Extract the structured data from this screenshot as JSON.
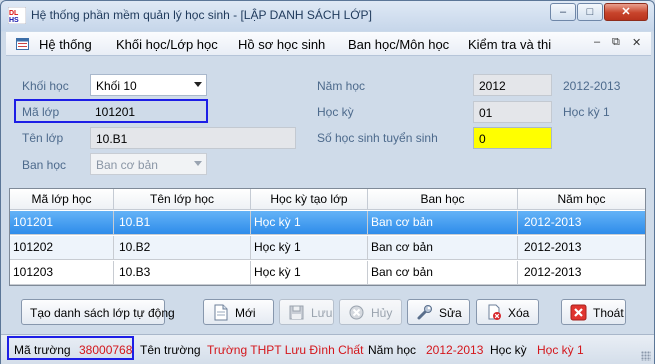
{
  "window": {
    "title": "Hệ thống phần mềm quản lý học sinh - [LẬP DANH SÁCH LỚP]",
    "min_symbol": "–",
    "max_symbol": "□",
    "close_symbol": "✕"
  },
  "menu": {
    "items": [
      "Hệ thống",
      "Khối học/Lớp học",
      "Hồ sơ học sinh",
      "Ban học/Môn học",
      "Kiểm tra và thi"
    ],
    "mdi_min": "–",
    "mdi_restore": "⧉",
    "mdi_close": "✕"
  },
  "form": {
    "khoi_hoc_label": "Khối học",
    "khoi_hoc_value": "Khối 10",
    "ma_lop_label": "Mã lớp",
    "ma_lop_value": "101201",
    "ten_lop_label": "Tên lớp",
    "ten_lop_value": "10.B1",
    "ban_hoc_label": "Ban học",
    "ban_hoc_value": "Ban cơ bản",
    "nam_hoc_label": "Năm học",
    "nam_hoc_value": "2012",
    "nam_hoc_text": "2012-2013",
    "hoc_ky_label": "Học kỳ",
    "hoc_ky_value": "01",
    "hoc_ky_text": "Học kỳ 1",
    "so_hs_label": "Số học sinh tuyển sinh",
    "so_hs_value": "0"
  },
  "grid": {
    "columns": [
      "Mã lớp học",
      "Tên lớp học",
      "Học kỳ tạo lớp",
      "Ban học",
      "Năm học"
    ],
    "rows": [
      [
        "101201",
        "10.B1",
        "Học kỳ 1",
        "Ban cơ bản",
        "2012-2013"
      ],
      [
        "101202",
        "10.B2",
        "Học kỳ 1",
        "Ban cơ bản",
        "2012-2013"
      ],
      [
        "101203",
        "10.B3",
        "Học kỳ 1",
        "Ban cơ bản",
        "2012-2013"
      ]
    ],
    "selected_row": 0
  },
  "buttons": {
    "auto_create": "Tạo danh sách lớp tự động",
    "new": "Mới",
    "save": "Lưu",
    "cancel": "Hủy",
    "edit": "Sửa",
    "delete": "Xóa",
    "exit": "Thoát"
  },
  "status": {
    "ma_truong_label": "Mã trường",
    "ma_truong_value": "38000768",
    "ten_truong_label": "Tên trường",
    "ten_truong_value": "Trường THPT Lưu Đình Chất",
    "nam_hoc_label": "Năm học",
    "nam_hoc_value": "2012-2013",
    "hoc_ky_label": "Học kỳ",
    "hoc_ky_value": "Học kỳ 1"
  },
  "colors": {
    "highlight_box": "#1d1ee6",
    "selected_row": "#3392ec",
    "status_value": "#d4161b",
    "yellow_field": "#ffff00"
  }
}
